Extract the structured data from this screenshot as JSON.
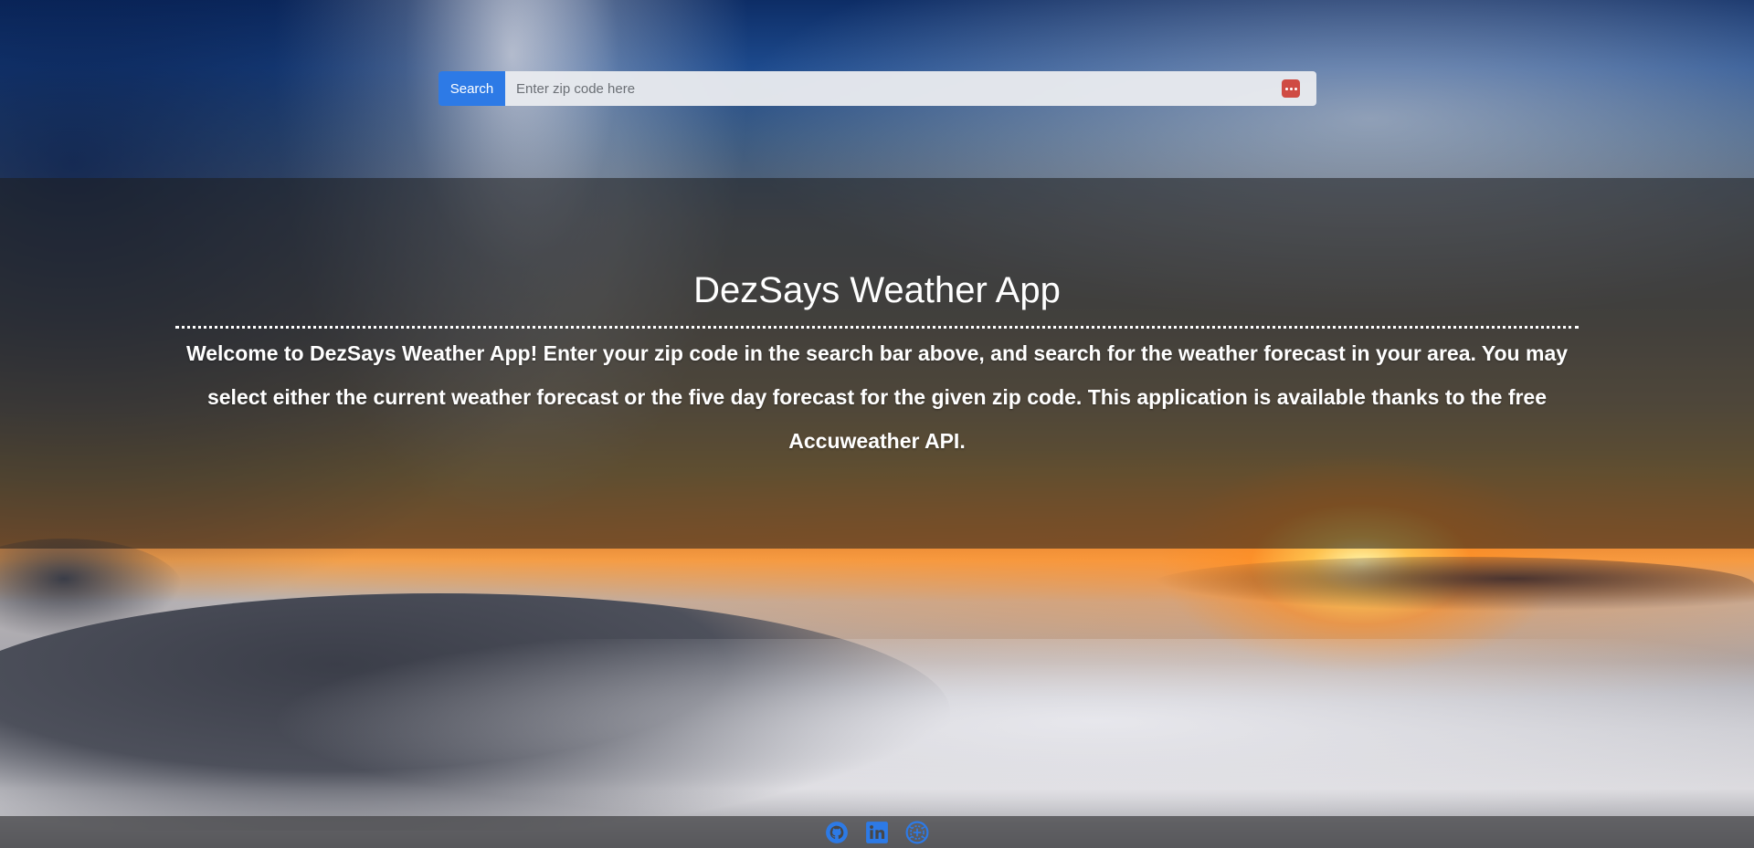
{
  "search": {
    "button_label": "Search",
    "placeholder": "Enter zip code here",
    "value": ""
  },
  "hero": {
    "title": "DezSays Weather App",
    "intro": "Welcome to DezSays Weather App! Enter your zip code in the search bar above, and search for the weather forecast in your area. You may select either the current weather forecast or the five day forecast for the given zip code. This application is available thanks to the free Accuweather API."
  },
  "footer": {
    "icons": [
      "github-icon",
      "linkedin-icon",
      "portfolio-icon"
    ]
  },
  "colors": {
    "accent": "#2d7ae6",
    "footer_icon": "#2d7ae6",
    "password_manager_icon": "#cf4b43"
  }
}
